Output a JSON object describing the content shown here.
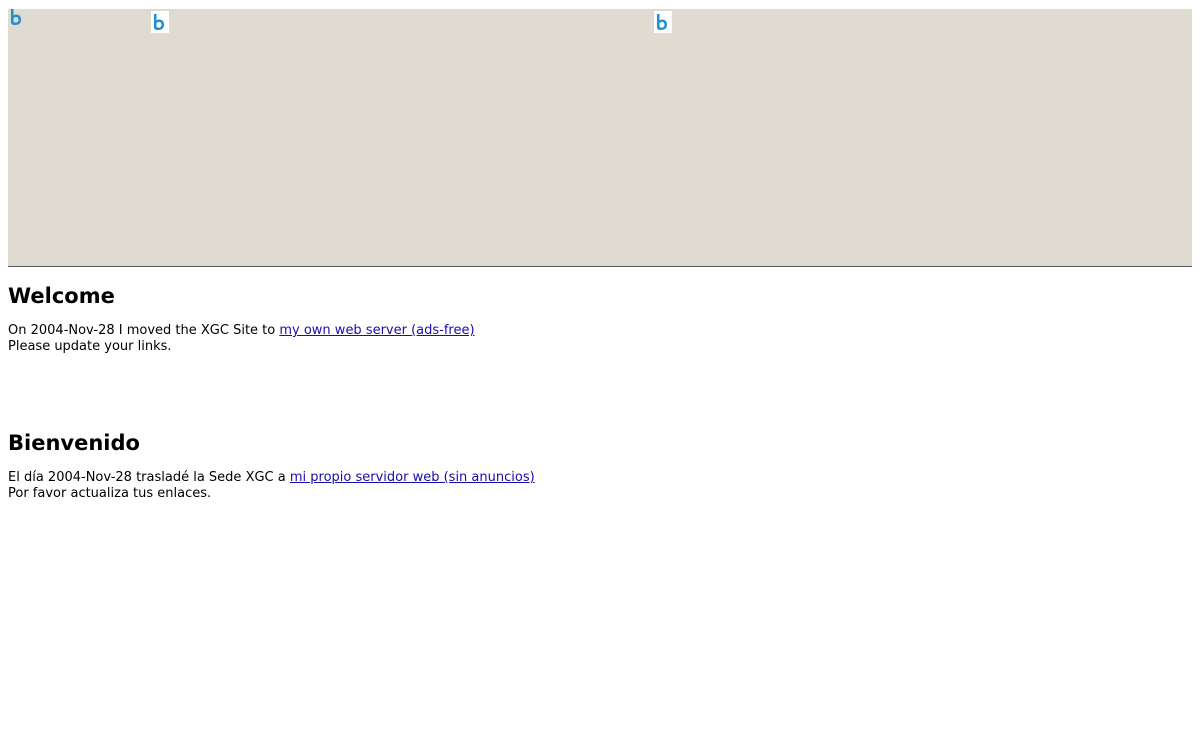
{
  "colors": {
    "banner_bg": "#dfdbd0",
    "link": "#1a0dab",
    "icon_blue": "#1c8fd6"
  },
  "banner": {
    "icons": [
      "broken-image-icon",
      "broken-image-icon",
      "broken-image-icon"
    ]
  },
  "english": {
    "heading": "Welcome",
    "line1_prefix": "On 2004-Nov-28 I moved the XGC Site to ",
    "link_text": "my own web server (ads-free)",
    "line2": "Please update your links."
  },
  "spanish": {
    "heading": "Bienvenido",
    "line1_prefix": "El día 2004-Nov-28 trasladé la Sede XGC a ",
    "link_text": "mi propio servidor web (sin anuncios)",
    "line2": "Por favor actualiza tus enlaces."
  }
}
